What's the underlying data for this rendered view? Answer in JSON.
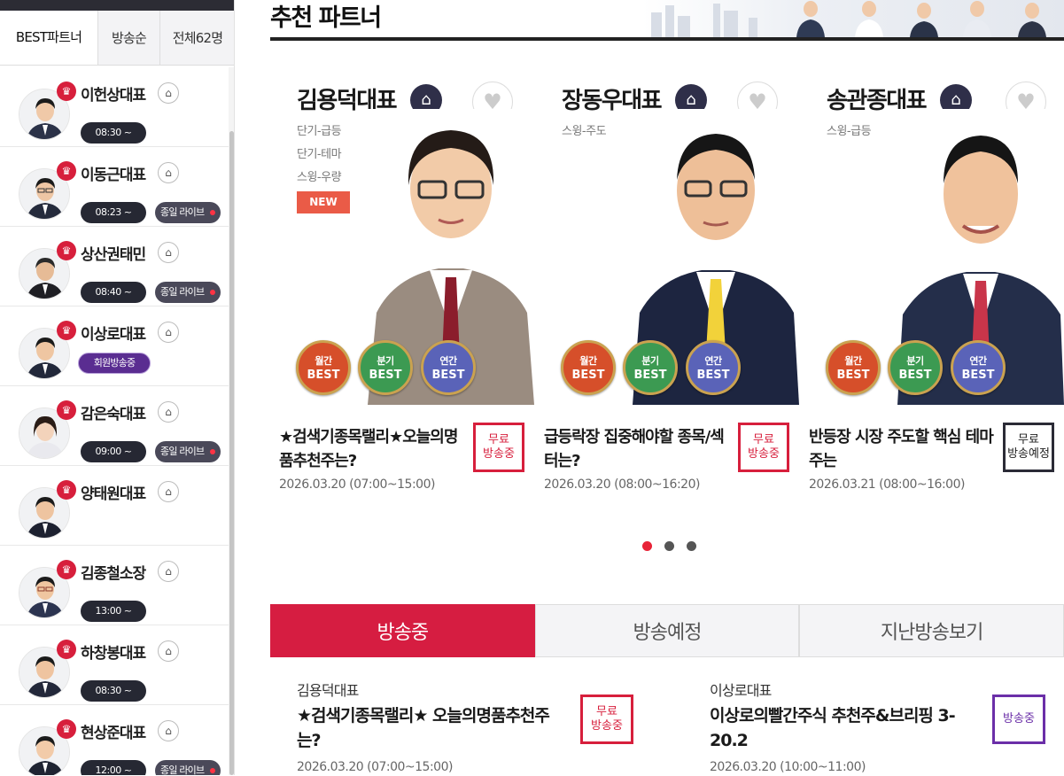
{
  "sidebar": {
    "tabs": [
      {
        "label": "BEST파트너",
        "active": true
      },
      {
        "label": "방송순",
        "active": false
      },
      {
        "label": "전체62명",
        "active": false
      }
    ],
    "partners": [
      {
        "name": "이헌상대표",
        "time": "08:30 ~",
        "live": ""
      },
      {
        "name": "이동근대표",
        "time": "08:23 ~",
        "live": "종일 라이브"
      },
      {
        "name": "상산권태민",
        "time": "08:40 ~",
        "live": "종일 라이브"
      },
      {
        "name": "이상로대표",
        "member": "회원방송중"
      },
      {
        "name": "감은숙대표",
        "time": "09:00 ~",
        "live": "종일 라이브"
      },
      {
        "name": "양태원대표"
      },
      {
        "name": "김종철소장",
        "time": "13:00 ~"
      },
      {
        "name": "하창봉대표",
        "time": "08:30 ~"
      },
      {
        "name": "현상준대표",
        "time": "12:00 ~",
        "live": "종일 라이브"
      }
    ]
  },
  "main": {
    "section_title": "추천 파트너",
    "cards": [
      {
        "name": "김용덕대표",
        "tags": [
          "단기-급등",
          "단기-테마",
          "스윙-우량"
        ],
        "new_label": "NEW",
        "desc": "★검색기종목랠리★오늘의명품추천주는?",
        "date": "2026.03.20 (07:00~15:00)",
        "status_line1": "무료",
        "status_line2": "방송중"
      },
      {
        "name": "장동우대표",
        "tags": [
          "스윙-주도"
        ],
        "desc": "급등락장 집중해야할 종목/섹터는?",
        "date": "2026.03.20 (08:00~16:20)",
        "status_line1": "무료",
        "status_line2": "방송중"
      },
      {
        "name": "송관종대표",
        "tags": [
          "스윙-급등"
        ],
        "desc": "반등장 시장 주도할 핵심 테마주는",
        "date": "2026.03.21 (08:00~16:00)",
        "status_line1": "무료",
        "status_line2": "방송예정"
      }
    ],
    "medals": [
      {
        "top": "월간",
        "bottom": "BEST"
      },
      {
        "top": "분기",
        "bottom": "BEST"
      },
      {
        "top": "연간",
        "bottom": "BEST"
      }
    ],
    "broadcast_tabs": [
      "방송중",
      "방송예정",
      "지난방송보기"
    ],
    "broadcasts": [
      {
        "host": "김용덕대표",
        "title": "★검색기종목랠리★ 오늘의명품추천주는?",
        "date": "2026.03.20 (07:00~15:00)",
        "status_line1": "무료",
        "status_line2": "방송중"
      },
      {
        "host": "이상로대표",
        "title": "이상로의빨간주식 추천주&브리핑 3-20.2",
        "date": "2026.03.20 (10:00~11:00)",
        "status": "방송중"
      }
    ]
  },
  "icons": {
    "crown": "crown-icon",
    "home": "home-icon",
    "heart": "heart-icon"
  },
  "colors": {
    "accent_red": "#d61d41",
    "dark_navy": "#262833",
    "purple": "#5a2d91"
  }
}
